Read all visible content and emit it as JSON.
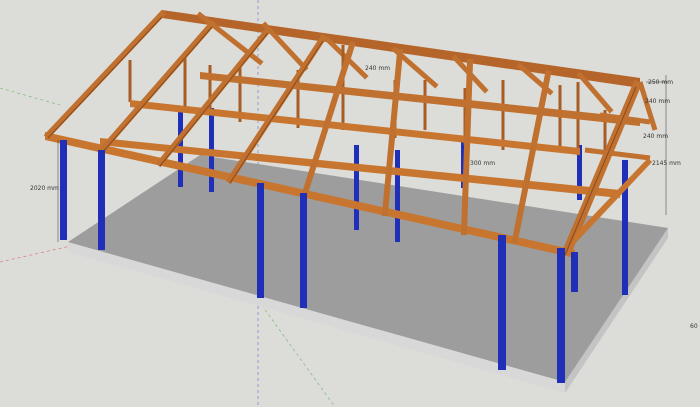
{
  "viewport": {
    "background": "#dcdcd8",
    "dimensions": {
      "column_height": "2020 mm",
      "side_height": "2145 mm",
      "truss_label_1": "240 mm",
      "truss_label_2": "250 mm",
      "truss_label_3": "240 mm",
      "truss_label_4": "300 mm",
      "truss_label_5": "240 mm",
      "edge_label": "60"
    }
  },
  "colors": {
    "floor": "#9e9e9e",
    "slab_edge": "#d6d6d6",
    "post": "#1f2fb8",
    "timber": "#c8732f",
    "timber_dark": "#8a4a1c",
    "axis_red": "#d23b3b",
    "axis_green": "#3ca63c",
    "axis_blue": "#3b3bd2"
  }
}
